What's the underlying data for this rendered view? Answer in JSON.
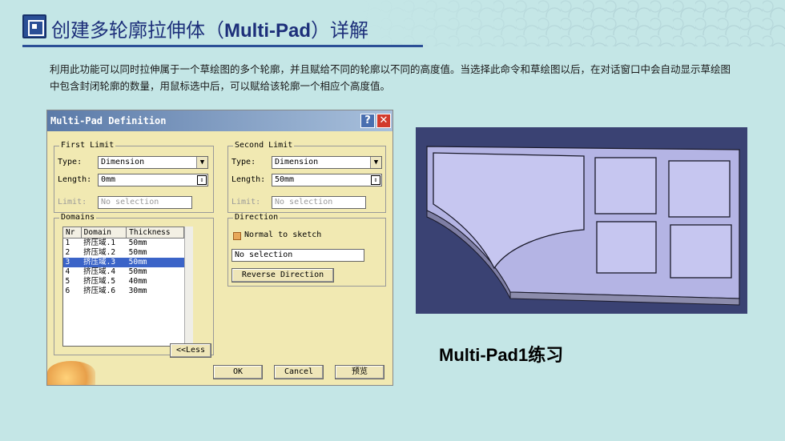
{
  "slide": {
    "title_prefix": "创建多轮廓拉伸体（",
    "title_bold": "Multi-Pad",
    "title_suffix": "）详解",
    "description": "利用此功能可以同时拉伸属于一个草绘图的多个轮廓，并且赋给不同的轮廓以不同的高度值。当选择此命令和草绘图以后，在对话窗口中会自动显示草绘图中包含封闭轮廓的数量，用鼠标选中后，可以赋给该轮廓一个相应个高度值。",
    "caption": "Multi-Pad1练习"
  },
  "dialog": {
    "title": "Multi-Pad Definition",
    "help_label": "?",
    "close_label": "✕",
    "first_limit": {
      "group_label": "First Limit",
      "type_label": "Type:",
      "type_value": "Dimension",
      "length_label": "Length:",
      "length_value": "0mm",
      "limit_label": "Limit:",
      "limit_value": "No selection"
    },
    "second_limit": {
      "group_label": "Second Limit",
      "type_label": "Type:",
      "type_value": "Dimension",
      "length_label": "Length:",
      "length_value": "50mm",
      "limit_label": "Limit:",
      "limit_value": "No selection"
    },
    "domains": {
      "group_label": "Domains",
      "columns": [
        "Nr",
        "Domain",
        "Thickness"
      ],
      "rows": [
        {
          "nr": "1",
          "domain": "挤压域.1",
          "thickness": "50mm"
        },
        {
          "nr": "2",
          "domain": "挤压域.2",
          "thickness": "50mm"
        },
        {
          "nr": "3",
          "domain": "挤压域.3",
          "thickness": "50mm"
        },
        {
          "nr": "4",
          "domain": "挤压域.4",
          "thickness": "50mm"
        },
        {
          "nr": "5",
          "domain": "挤压域.5",
          "thickness": "40mm"
        },
        {
          "nr": "6",
          "domain": "挤压域.6",
          "thickness": "30mm"
        }
      ],
      "selected_index": 2
    },
    "direction": {
      "group_label": "Direction",
      "normal_label": "Normal to sketch",
      "selection_value": "No selection",
      "reverse_label": "Reverse Direction"
    },
    "less_label": "<<Less",
    "ok_label": "OK",
    "cancel_label": "Cancel",
    "preview_label": "预览"
  },
  "colors": {
    "background": "#c4e6e6",
    "title": "#1d2f7a",
    "dialog_bg": "#f1e9b2",
    "selection": "#3b64c8",
    "viewport_bg": "#3a4273",
    "part_face": "#bcbcec"
  }
}
